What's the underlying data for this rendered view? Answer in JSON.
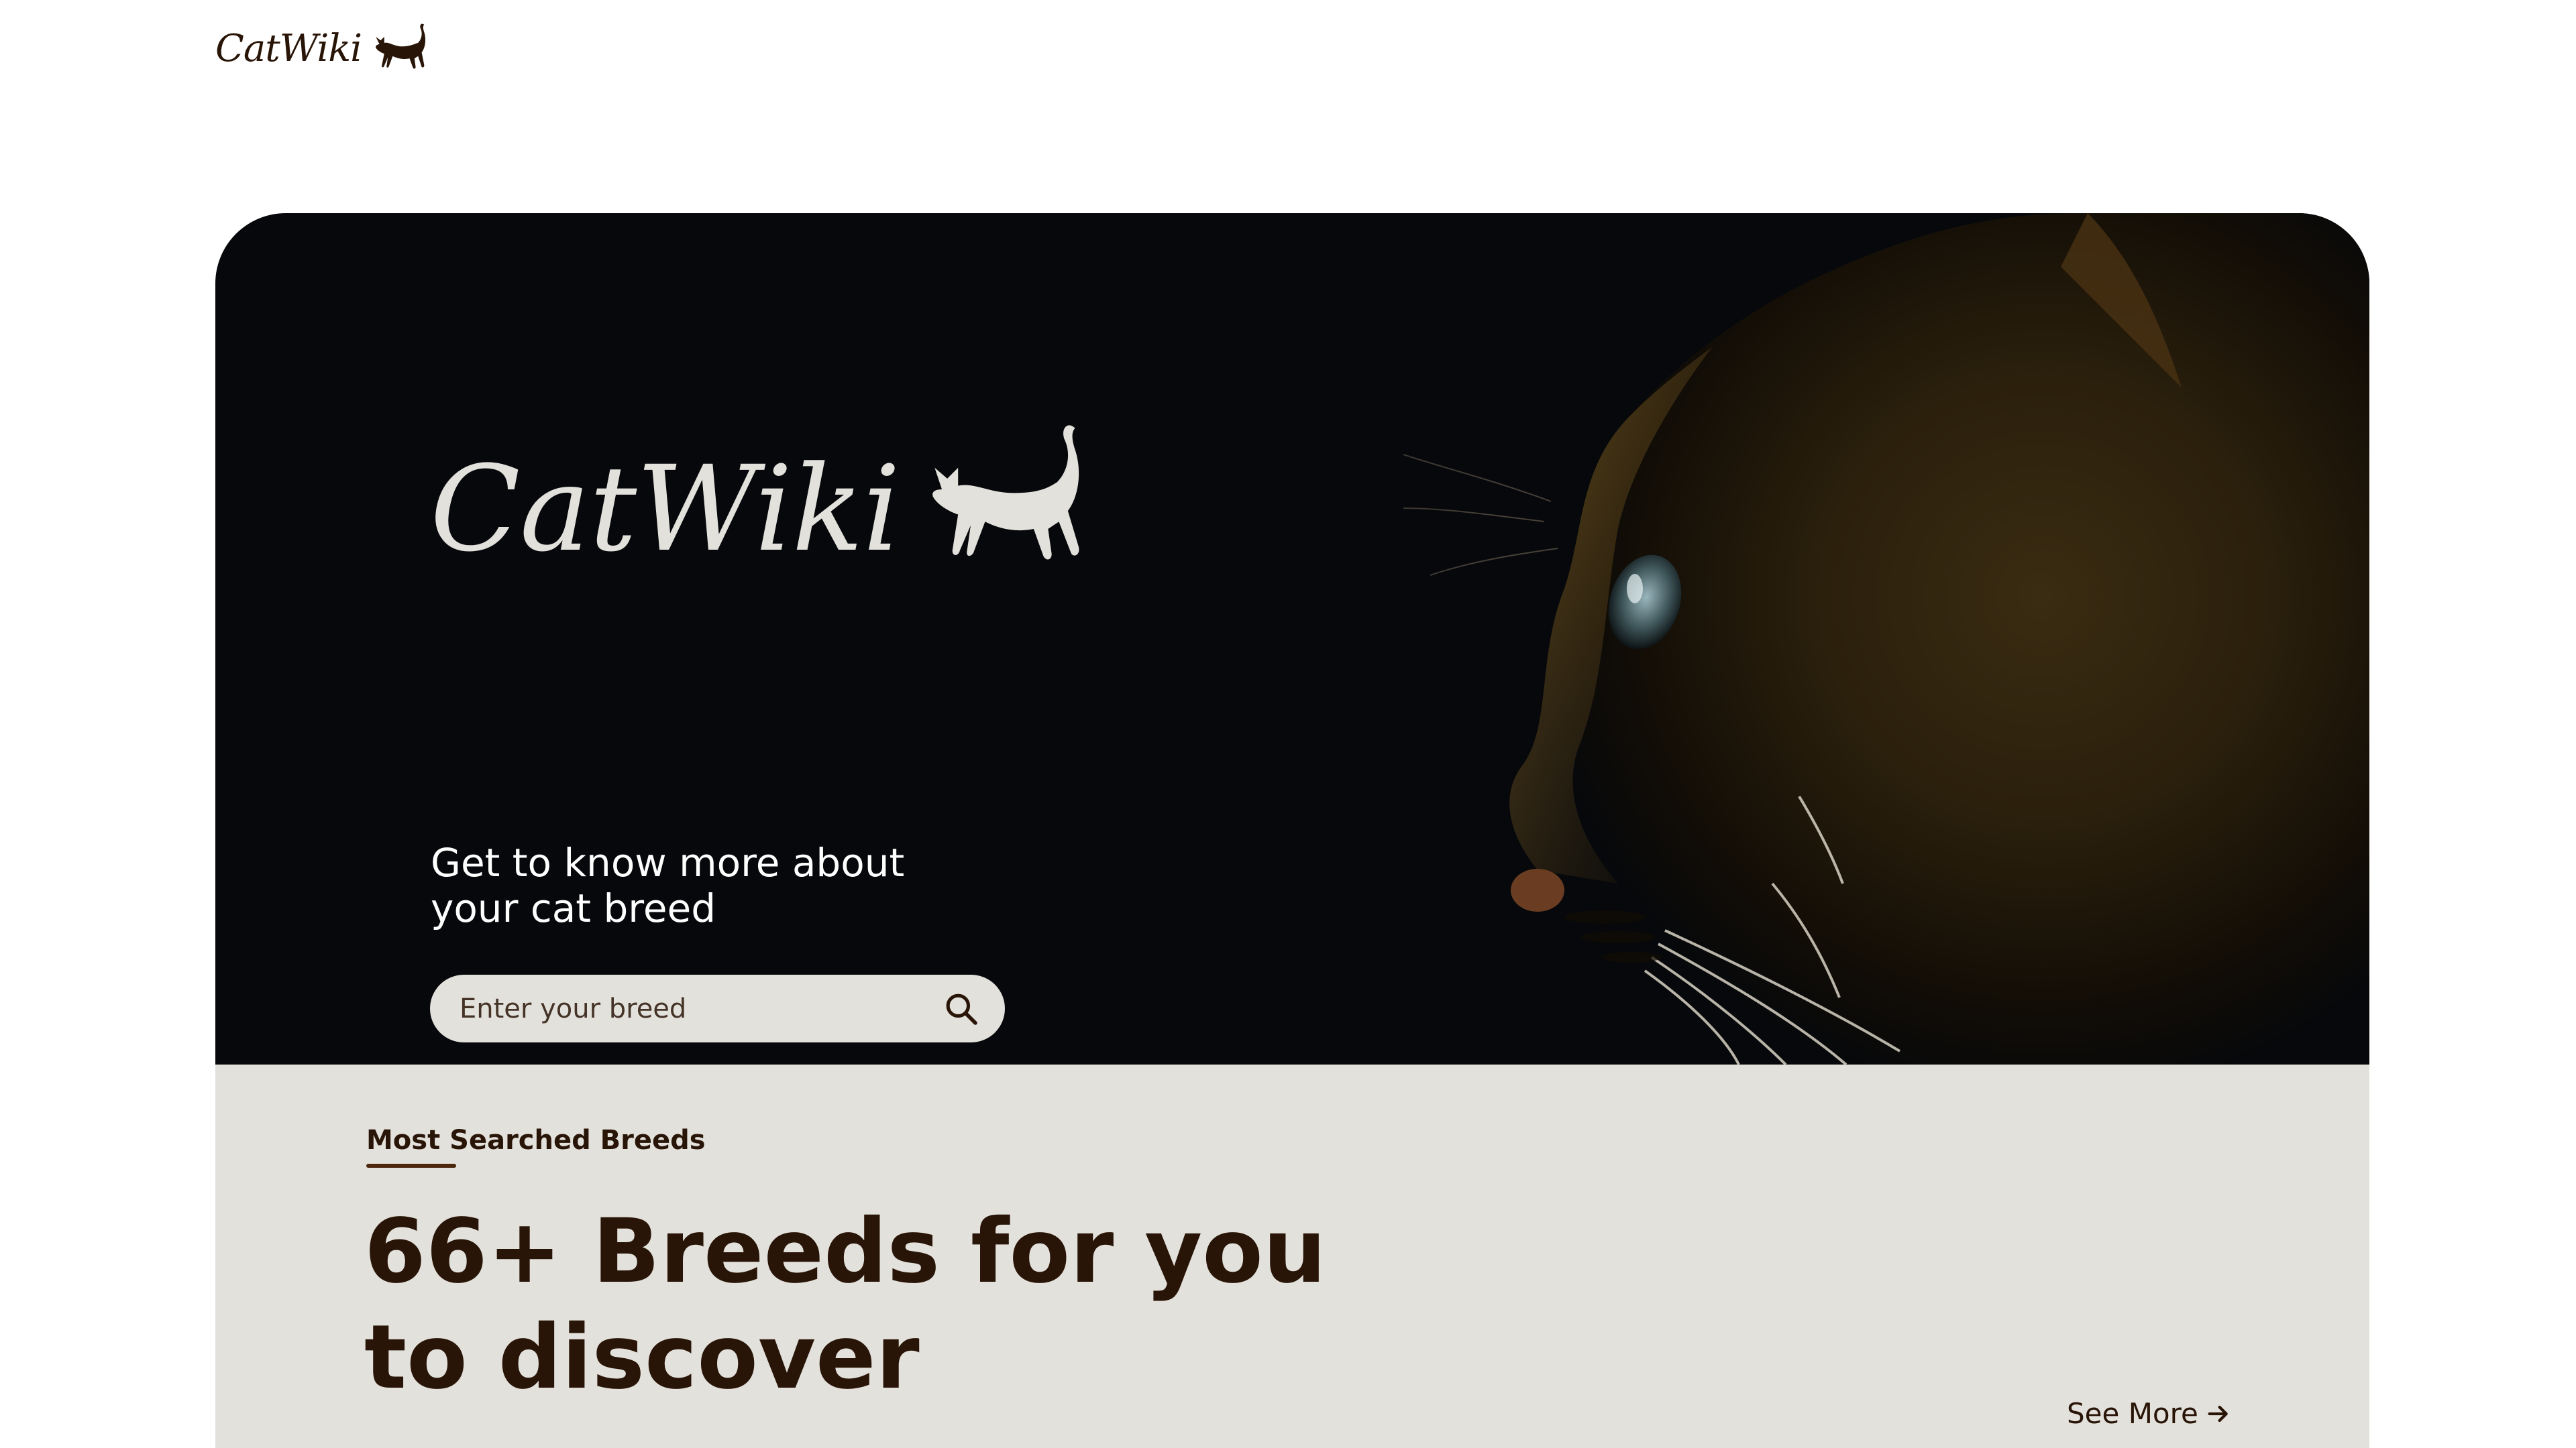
{
  "header": {
    "logo_text": "CatWiki",
    "logo_icon": "cat-silhouette-icon"
  },
  "hero": {
    "logo_text": "CatWiki",
    "logo_icon": "cat-silhouette-icon",
    "tagline_line1": "Get to know more about",
    "tagline_line2": "your cat breed",
    "search": {
      "placeholder": "Enter your breed",
      "value": "",
      "icon": "search-icon"
    },
    "photo": "cat-profile-photo"
  },
  "breeds_section": {
    "label": "Most Searched Breeds",
    "title_line1": "66+ Breeds for you",
    "title_line2": "to discover",
    "see_more_label": "See More",
    "see_more_icon": "arrow-right-icon"
  },
  "colors": {
    "brand_dark": "#291507",
    "hero_bg": "#06080b",
    "section_bg": "#e3e1dc",
    "search_bg": "#e3e1dc"
  }
}
